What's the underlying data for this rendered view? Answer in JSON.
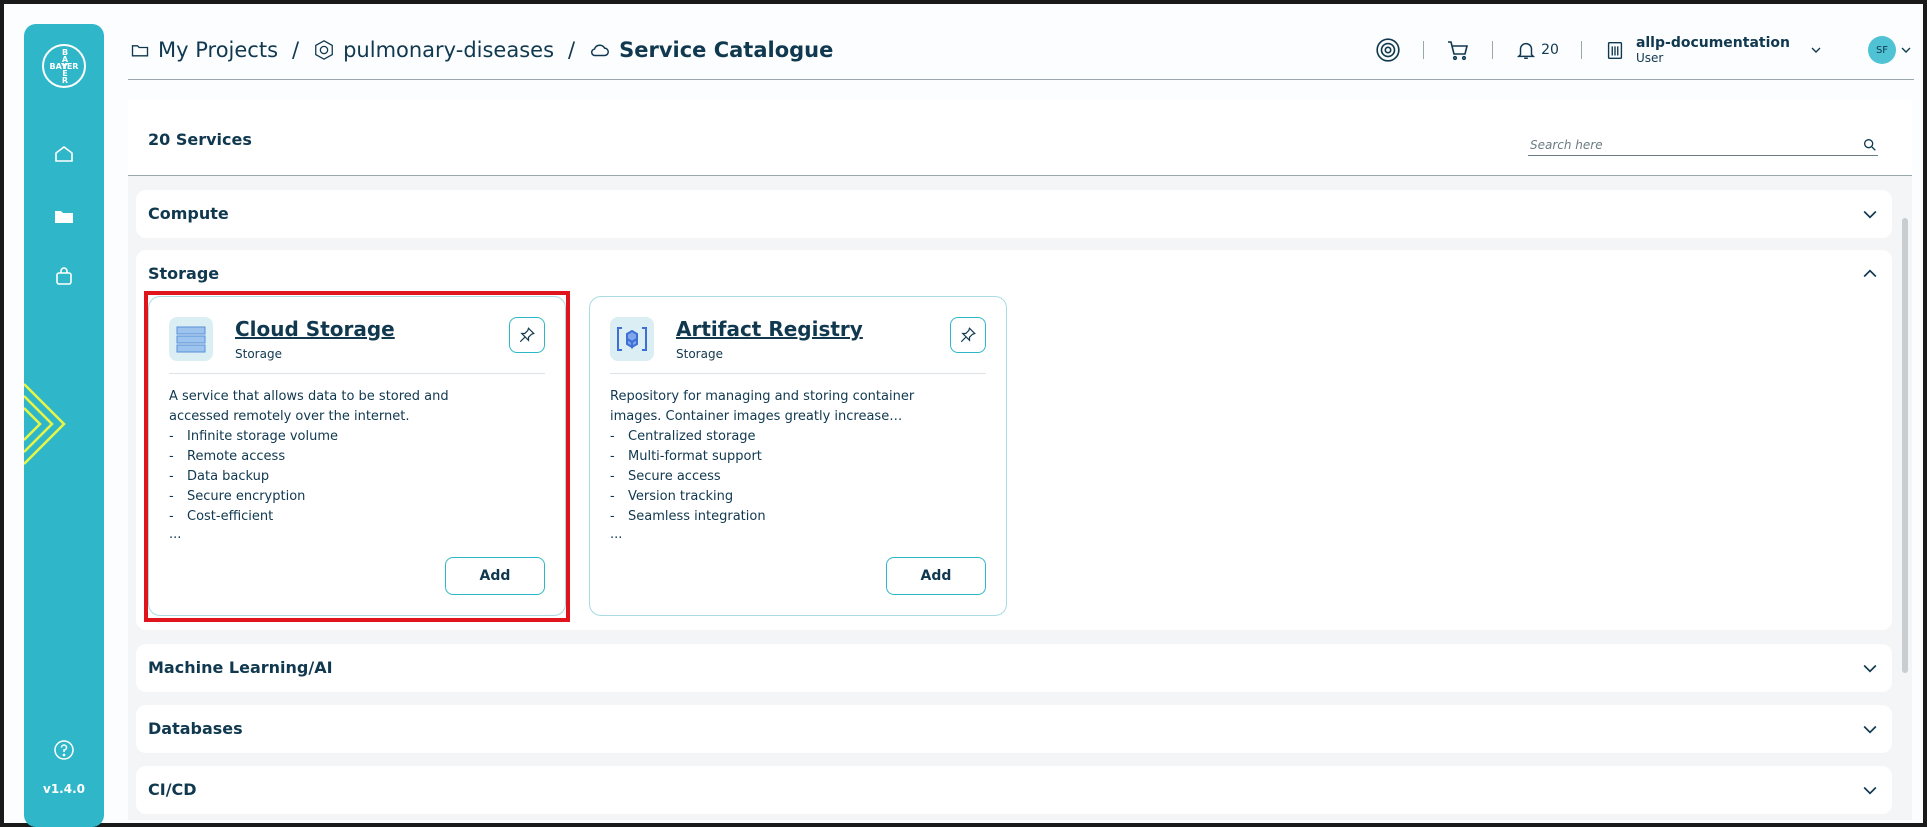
{
  "sidebar": {
    "logo_horizontal": "BAYER",
    "logo_vertical": "BAYER",
    "version": "v1.4.0"
  },
  "breadcrumb": {
    "items": [
      "My Projects",
      "pulmonary-diseases",
      "Service Catalogue"
    ],
    "separator": "/"
  },
  "header": {
    "notifications_count": "20",
    "user_name": "allp-documentation",
    "user_role": "User",
    "avatar_initials": "SF"
  },
  "catalogue": {
    "count_label": "20 Services",
    "search_placeholder": "Search here",
    "categories": [
      "Compute",
      "Storage",
      "Machine Learning/AI",
      "Databases",
      "CI/CD"
    ]
  },
  "cards": [
    {
      "title": "Cloud Storage",
      "subtitle": "Storage",
      "description": "A service that allows data to be stored and accessed remotely over the internet.",
      "features": [
        "Infinite storage volume",
        "Remote access",
        "Data backup",
        "Secure encryption",
        "Cost-efficient"
      ],
      "more": "...",
      "add_label": "Add"
    },
    {
      "title": "Artifact Registry",
      "subtitle": "Storage",
      "description": "Repository for managing and storing container images. Container images greatly increase…",
      "features": [
        "Centralized storage",
        "Multi-format support",
        "Secure access",
        "Version tracking",
        "Seamless integration"
      ],
      "more": "...",
      "add_label": "Add"
    }
  ],
  "colors": {
    "sidebar": "#2fb7c9",
    "text": "#10384f",
    "highlight": "#e0141c"
  }
}
